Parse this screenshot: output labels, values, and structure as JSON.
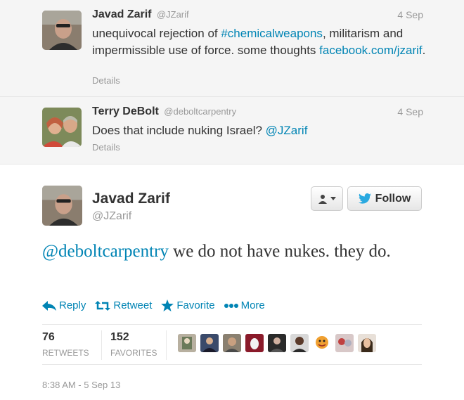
{
  "conversation": [
    {
      "name": "Javad Zarif",
      "screen_name": "@JZarif",
      "date": "4 Sep",
      "text_pre": "unequivocal rejection of ",
      "hashtag": "#chemicalweapons",
      "text_post": ", militarism and impermissible use of force. some thoughts ",
      "link": "facebook.com/jzarif",
      "text_end": ".",
      "details": "Details"
    },
    {
      "name": "Terry DeBolt",
      "screen_name": "@deboltcarpentry",
      "date": "4 Sep",
      "text_pre": "Does that include nuking Israel? ",
      "mention": "@JZarif",
      "details": "Details"
    }
  ],
  "main_tweet": {
    "name": "Javad Zarif",
    "screen_name": "@JZarif",
    "mention": "@deboltcarpentry",
    "text": " we do not have nukes. they do.",
    "follow_label": "Follow",
    "actions": {
      "reply": "Reply",
      "retweet": "Retweet",
      "favorite": "Favorite",
      "more": "More"
    },
    "stats": {
      "retweets_count": "76",
      "retweets_label": "RETWEETS",
      "favorites_count": "152",
      "favorites_label": "FAVORITES"
    },
    "timestamp": "8:38 AM - 5 Sep 13"
  },
  "colors": {
    "link": "#0084b4",
    "muted": "#999999",
    "text": "#333333",
    "conversation_bg": "#f5f5f5"
  }
}
